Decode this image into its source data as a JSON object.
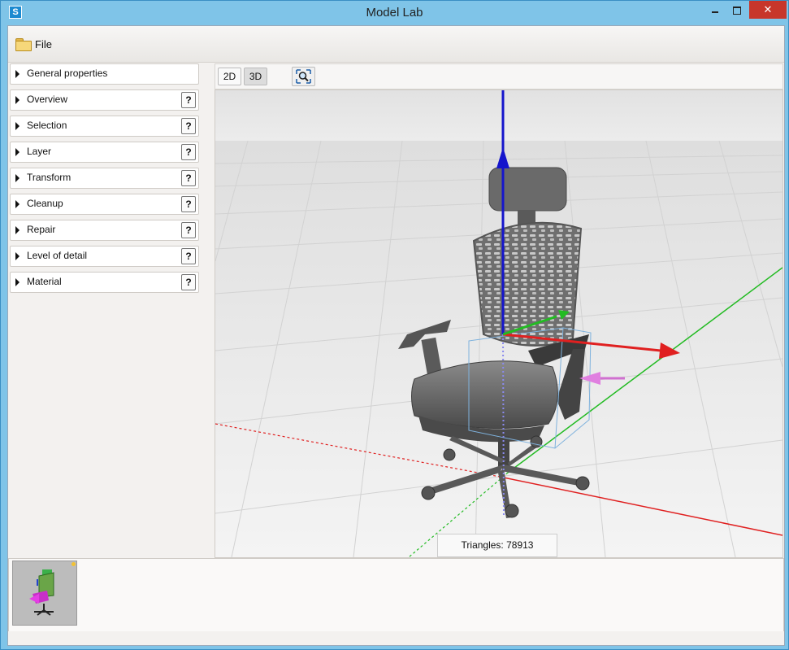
{
  "window": {
    "title": "Model Lab",
    "app_icon_glyph": "S",
    "close_glyph": "✕",
    "accent_color": "#7fc4e8",
    "close_color": "#c7362b"
  },
  "menu": {
    "file_label": "File",
    "file_icon": "folder-icon"
  },
  "sidebar": {
    "general": {
      "label": "General properties"
    },
    "items": [
      {
        "label": "Overview",
        "help": "?"
      },
      {
        "label": "Selection",
        "help": "?"
      },
      {
        "label": "Layer",
        "help": "?"
      },
      {
        "label": "Transform",
        "help": "?"
      },
      {
        "label": "Cleanup",
        "help": "?"
      },
      {
        "label": "Repair",
        "help": "?"
      },
      {
        "label": "Level of detail",
        "help": "?"
      },
      {
        "label": "Material",
        "help": "?"
      }
    ]
  },
  "view_toolbar": {
    "btn_2d": "2D",
    "btn_3d": "3D",
    "active_mode": "3D",
    "fit_icon": "zoom-extents-icon"
  },
  "viewport": {
    "triangles_text": "Triangles: 78913",
    "axis_colors": {
      "x": "#e02020",
      "y": "#22bb22",
      "z": "#1515cc"
    },
    "model": "office chair"
  },
  "asset_bar": {
    "thumbnail": "office-chair-thumbnail",
    "badge_color": "#f2c233"
  }
}
